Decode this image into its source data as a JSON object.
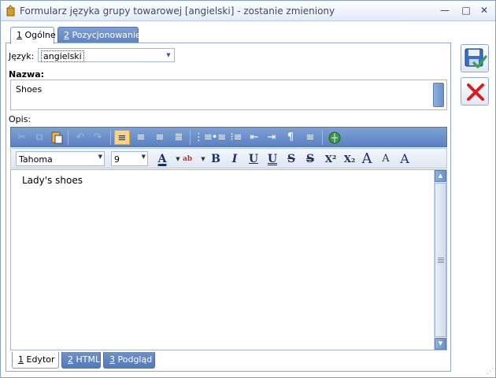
{
  "window": {
    "title": "Formularz języka grupy towarowej [angielski] - zostanie zmieniony"
  },
  "title_buttons": {
    "minimize": "—",
    "maximize": "□",
    "close": "✕"
  },
  "tabs_top": [
    {
      "num": "1",
      "label": " Ogólne"
    },
    {
      "num": "2",
      "label": " Pozycjonowanie"
    }
  ],
  "form": {
    "language_label": "Język:",
    "language_value": "angielski",
    "name_label": "Nazwa:",
    "name_value": "Shoes",
    "description_label": "Opis:"
  },
  "editor_toolbar": {
    "font_family": "Tahoma",
    "font_size": "9",
    "format_buttons": [
      "A",
      "ab",
      "B",
      "I",
      "U",
      "U",
      "S",
      "S",
      "X²",
      "X₂",
      "A",
      "A",
      "A"
    ]
  },
  "editor": {
    "content": "Lady's shoes"
  },
  "tabs_bottom": [
    {
      "num": "1",
      "label": " Edytor"
    },
    {
      "num": "2",
      "label": " HTML"
    },
    {
      "num": "3",
      "label": " Podgląd"
    }
  ],
  "colors": {
    "accent": "#5c81c3",
    "save_check": "#3aa14a",
    "cancel_x": "#d81e1e"
  },
  "icons": {
    "save": "save-disk-check-icon",
    "cancel": "cancel-x-icon"
  }
}
